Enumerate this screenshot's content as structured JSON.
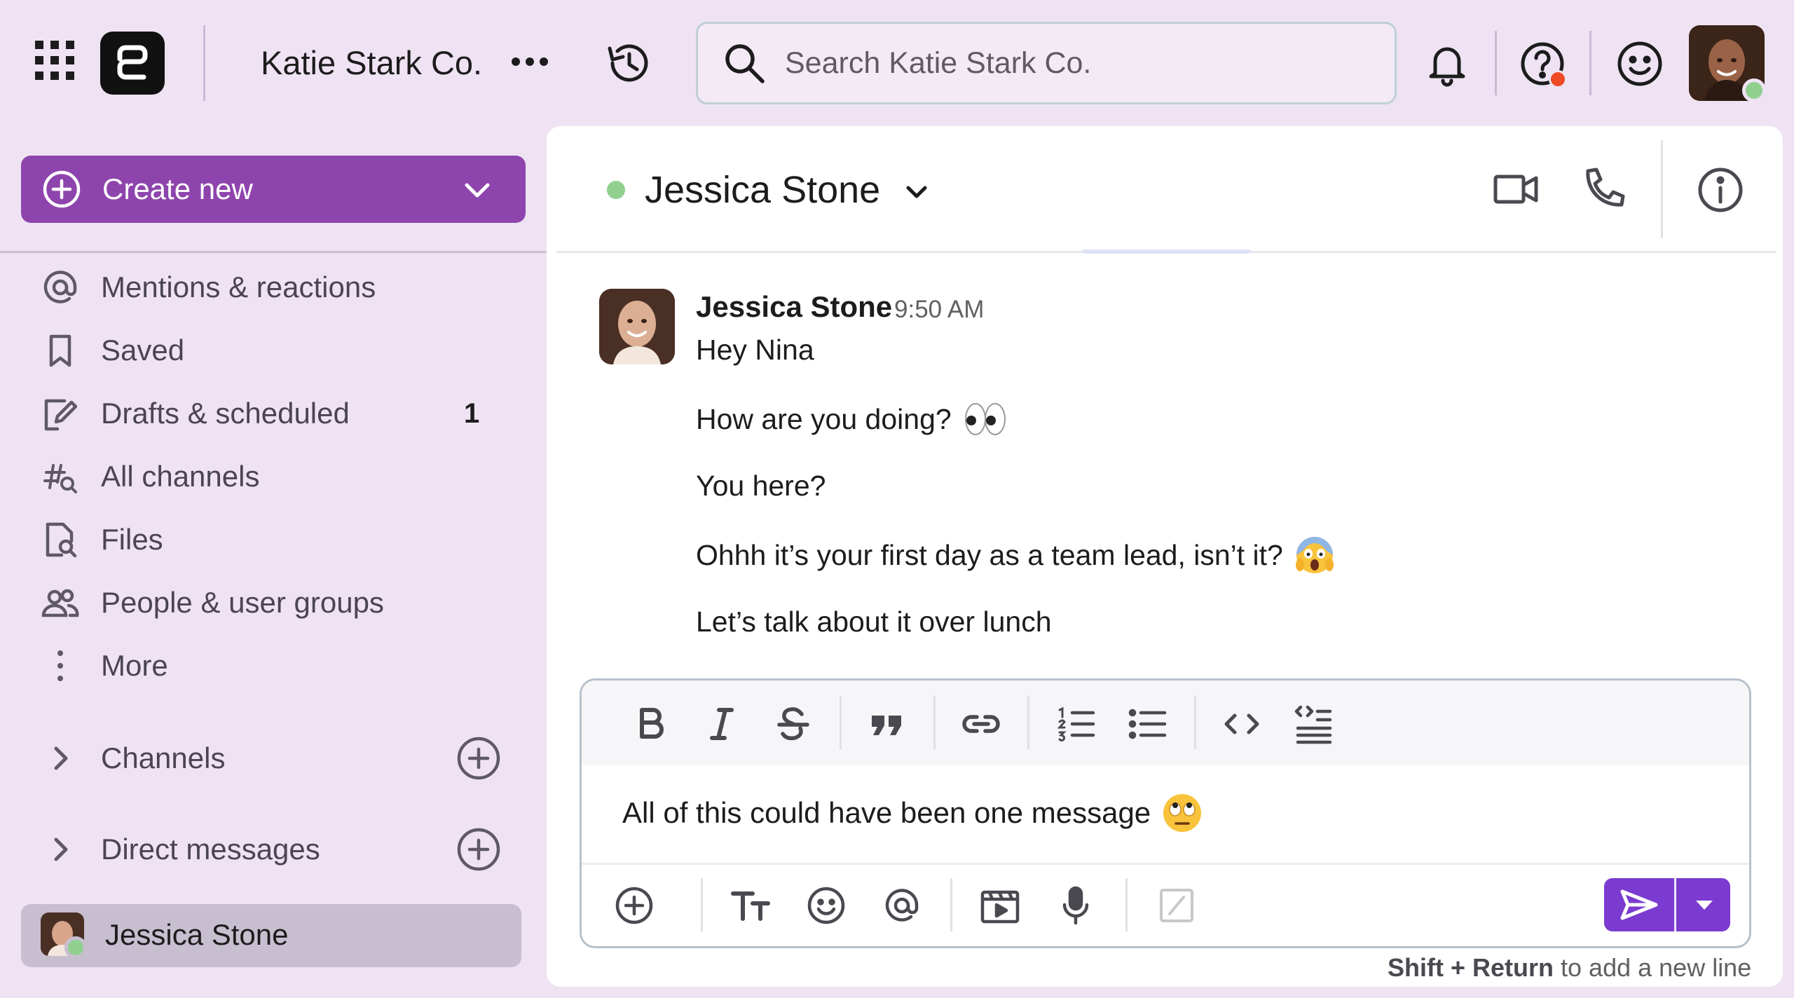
{
  "colors": {
    "background": "#efe3f3",
    "create_button": "#8e44ad",
    "send_button": "#7b3bd0",
    "online_status": "#8fd08f",
    "help_badge": "#ef4a24"
  },
  "topbar": {
    "workspace_name": "Katie Stark Co.",
    "search_placeholder": "Search Katie Stark Co.",
    "icons": [
      "grid-menu-icon",
      "app-logo-icon",
      "more-horizontal-icon",
      "history-icon",
      "search-icon",
      "bell-icon",
      "help-icon",
      "smile-icon",
      "user-avatar"
    ]
  },
  "sidebar": {
    "create_label": "Create new",
    "nav": [
      {
        "icon": "at-icon",
        "label": "Mentions & reactions"
      },
      {
        "icon": "bookmark-icon",
        "label": "Saved"
      },
      {
        "icon": "draft-edit-icon",
        "label": "Drafts & scheduled",
        "count": "1"
      },
      {
        "icon": "channel-search-icon",
        "label": "All channels"
      },
      {
        "icon": "file-search-icon",
        "label": "Files"
      },
      {
        "icon": "people-icon",
        "label": "People & user groups"
      },
      {
        "icon": "more-vertical-icon",
        "label": "More"
      }
    ],
    "sections": [
      {
        "label": "Channels"
      },
      {
        "label": "Direct messages"
      }
    ],
    "active_dm": {
      "name": "Jessica Stone"
    }
  },
  "conversation": {
    "contact_name": "Jessica Stone",
    "header_icons": [
      "video-icon",
      "phone-icon",
      "info-icon"
    ],
    "message": {
      "sender": "Jessica Stone",
      "time": "9:50 AM",
      "lines": [
        {
          "text": "Hey Nina",
          "emoji": ""
        },
        {
          "text": "How are you doing?",
          "emoji": "eyes"
        },
        {
          "text": "You here?",
          "emoji": ""
        },
        {
          "text": "Ohhh it’s your first day as a team lead, isn’t it?",
          "emoji": "face-screaming"
        },
        {
          "text": "Let’s talk about it over lunch",
          "emoji": ""
        }
      ]
    }
  },
  "composer": {
    "format_icons": [
      "bold-icon",
      "italic-icon",
      "strikethrough-icon",
      "quote-icon",
      "link-icon",
      "numbered-list-icon",
      "bulleted-list-icon",
      "code-icon",
      "code-block-icon"
    ],
    "draft_text": "All of this could have been one message",
    "draft_emoji": "face-rolling-eyes",
    "action_icons": [
      "add-circle-icon",
      "text-format-icon",
      "emoji-icon",
      "mention-icon",
      "video-clip-icon",
      "microphone-icon",
      "slash-command-icon"
    ],
    "hint_keys": "Shift + Return",
    "hint_rest": "to add a new line"
  }
}
